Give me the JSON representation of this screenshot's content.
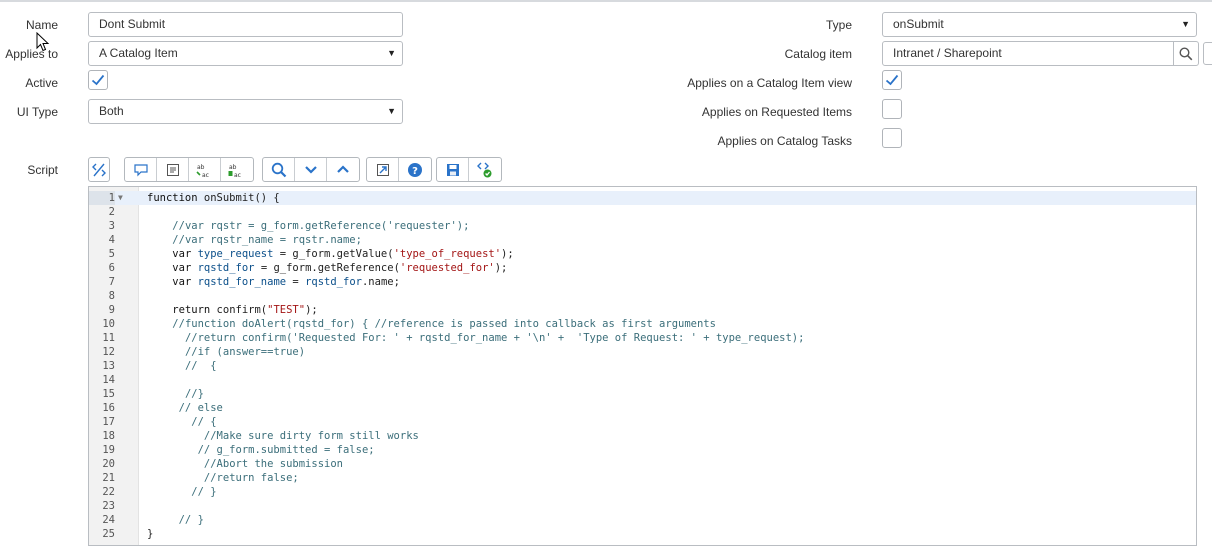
{
  "form": {
    "name_label": "Name",
    "name_value": "Dont Submit",
    "applies_to_label": "Applies to",
    "applies_to_value": "A Catalog Item",
    "active_label": "Active",
    "ui_type_label": "UI Type",
    "ui_type_value": "Both",
    "type_label": "Type",
    "type_value": "onSubmit",
    "catalog_item_label": "Catalog item",
    "catalog_item_value": "Intranet / Sharepoint",
    "applies_on_view_label": "Applies on a Catalog Item view",
    "applies_on_requested_label": "Applies on Requested Items",
    "applies_on_tasks_label": "Applies on Catalog Tasks",
    "script_label": "Script",
    "checkboxes": {
      "active": true,
      "applies_on_view": true,
      "applies_on_requested": false,
      "applies_on_tasks": false
    }
  },
  "toolbar": {
    "icons": [
      "toggle-syntax-icon",
      "comment-icon",
      "format-icon",
      "replace-icon",
      "replace-all-icon",
      "search-icon",
      "fold-down-icon",
      "fold-up-icon",
      "fullscreen-icon",
      "help-icon",
      "save-icon",
      "script-debug-icon"
    ]
  },
  "editor": {
    "lines": [
      {
        "n": "1",
        "code": "function onSubmit() {"
      },
      {
        "n": "2",
        "code": ""
      },
      {
        "n": "3",
        "code": "    //var rqstr = g_form.getReference('requester');"
      },
      {
        "n": "4",
        "code": "    //var rqstr_name = rqstr.name;"
      },
      {
        "n": "5",
        "code": "    var type_request = g_form.getValue('type_of_request');"
      },
      {
        "n": "6",
        "code": "    var rqstd_for = g_form.getReference('requested_for');"
      },
      {
        "n": "7",
        "code": "    var rqstd_for_name = rqstd_for.name;"
      },
      {
        "n": "8",
        "code": ""
      },
      {
        "n": "9",
        "code": "    return confirm(\"TEST\");"
      },
      {
        "n": "10",
        "code": "    //function doAlert(rqstd_for) { //reference is passed into callback as first arguments"
      },
      {
        "n": "11",
        "code": "      //return confirm('Requested For: ' + rqstd_for_name + '\\n' +  'Type of Request: ' + type_request);"
      },
      {
        "n": "12",
        "code": "      //if (answer==true)"
      },
      {
        "n": "13",
        "code": "      //  {"
      },
      {
        "n": "14",
        "code": ""
      },
      {
        "n": "15",
        "code": "      //}"
      },
      {
        "n": "16",
        "code": "     // else"
      },
      {
        "n": "17",
        "code": "       // {"
      },
      {
        "n": "18",
        "code": "         //Make sure dirty form still works"
      },
      {
        "n": "19",
        "code": "        // g_form.submitted = false;"
      },
      {
        "n": "20",
        "code": "         //Abort the submission"
      },
      {
        "n": "21",
        "code": "         //return false;"
      },
      {
        "n": "22",
        "code": "       // }"
      },
      {
        "n": "23",
        "code": ""
      },
      {
        "n": "24",
        "code": "     // }"
      },
      {
        "n": "25",
        "code": "}"
      }
    ]
  },
  "colors": {
    "accent": "#2a73c9",
    "comment": "#3b6e7a",
    "string": "#a31515"
  }
}
